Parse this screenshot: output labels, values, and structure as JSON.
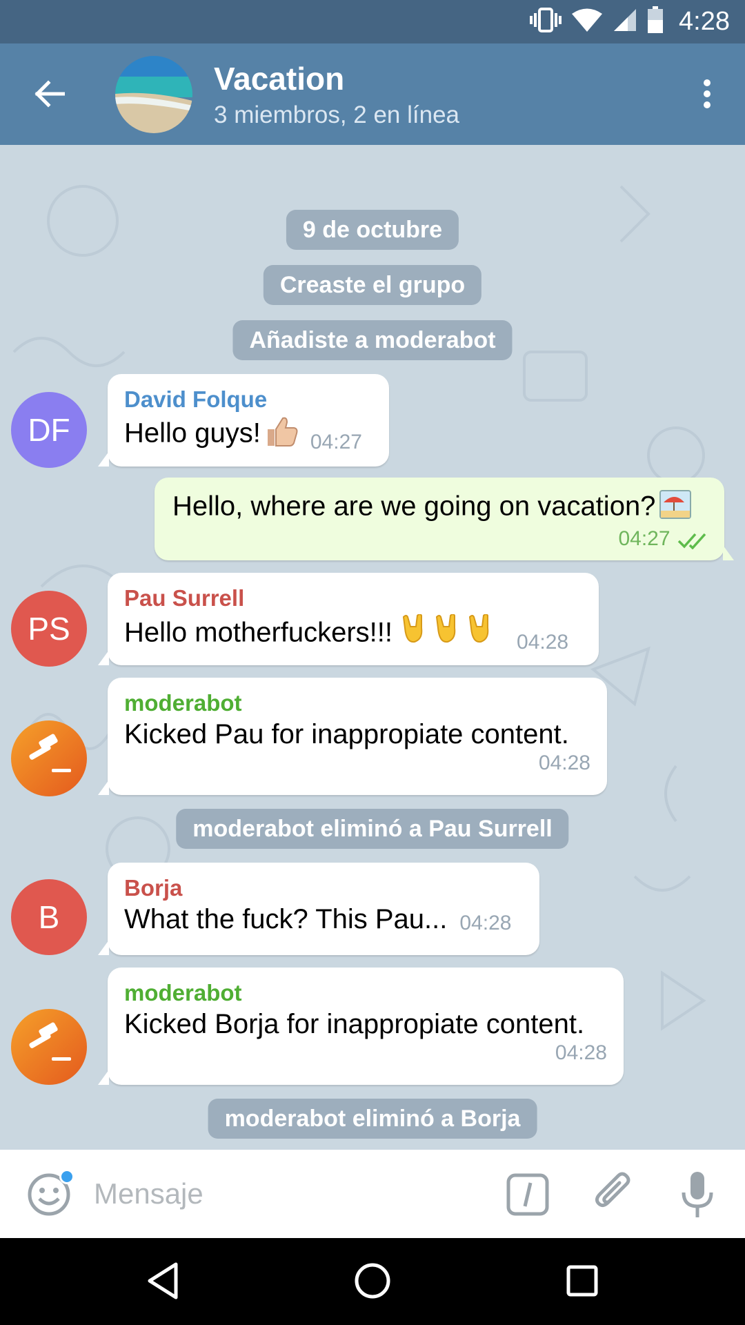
{
  "status_bar": {
    "time": "4:28",
    "icons": [
      "vibrate-icon",
      "wifi-icon",
      "signal-icon",
      "battery-icon"
    ]
  },
  "header": {
    "title": "Vacation",
    "subtitle": "3 miembros, 2 en línea",
    "icons": [
      "back-arrow-icon",
      "more-vert-icon"
    ]
  },
  "chat": {
    "service": {
      "date": "9 de octubre",
      "created": "Creaste el grupo",
      "added": "Añadiste a moderabot",
      "removed_pau": "moderabot eliminó a Pau Surrell",
      "removed_borja": "moderabot eliminó a Borja"
    },
    "messages": [
      {
        "sender": "David Folque",
        "initials": "DF",
        "text": "Hello guys!",
        "time": "04:27",
        "emoji": "thumbs-up",
        "sender_color": "#4d8fcc",
        "avatar_color": "#8a7ef0"
      },
      {
        "outgoing": true,
        "text": "Hello, where are we going on vacation?",
        "time": "04:27",
        "emoji": "beach",
        "status": "read"
      },
      {
        "sender": "Pau Surrell",
        "initials": "PS",
        "text": "Hello motherfuckers!!!",
        "time": "04:28",
        "emoji": "horns x3",
        "sender_color": "#c9514b",
        "avatar_color": "#e0584f"
      },
      {
        "sender": "moderabot",
        "text": "Kicked Pau for inappropiate content.",
        "time": "04:28",
        "sender_color": "#4fae33",
        "avatar": "gavel-icon"
      },
      {
        "sender": "Borja",
        "initials": "B",
        "text": "What the fuck? This Pau...",
        "time": "04:28",
        "sender_color": "#c9514b",
        "avatar_color": "#e0584f"
      },
      {
        "sender": "moderabot",
        "text": "Kicked Borja for inappropiate content.",
        "time": "04:28",
        "sender_color": "#4fae33",
        "avatar": "gavel-icon"
      }
    ]
  },
  "input": {
    "placeholder": "Mensaje",
    "icons": [
      "emoji-icon",
      "slash-command-icon",
      "paperclip-icon",
      "microphone-icon"
    ]
  },
  "nav_bar": {
    "buttons": [
      "back-triangle-icon",
      "home-circle-icon",
      "recents-square-icon"
    ]
  },
  "colors": {
    "status_bar": "#456583",
    "header": "#5682a7",
    "chat_bg": "#cad7e0",
    "outgoing_bubble": "#effdde",
    "time_out": "#6fb55c"
  }
}
